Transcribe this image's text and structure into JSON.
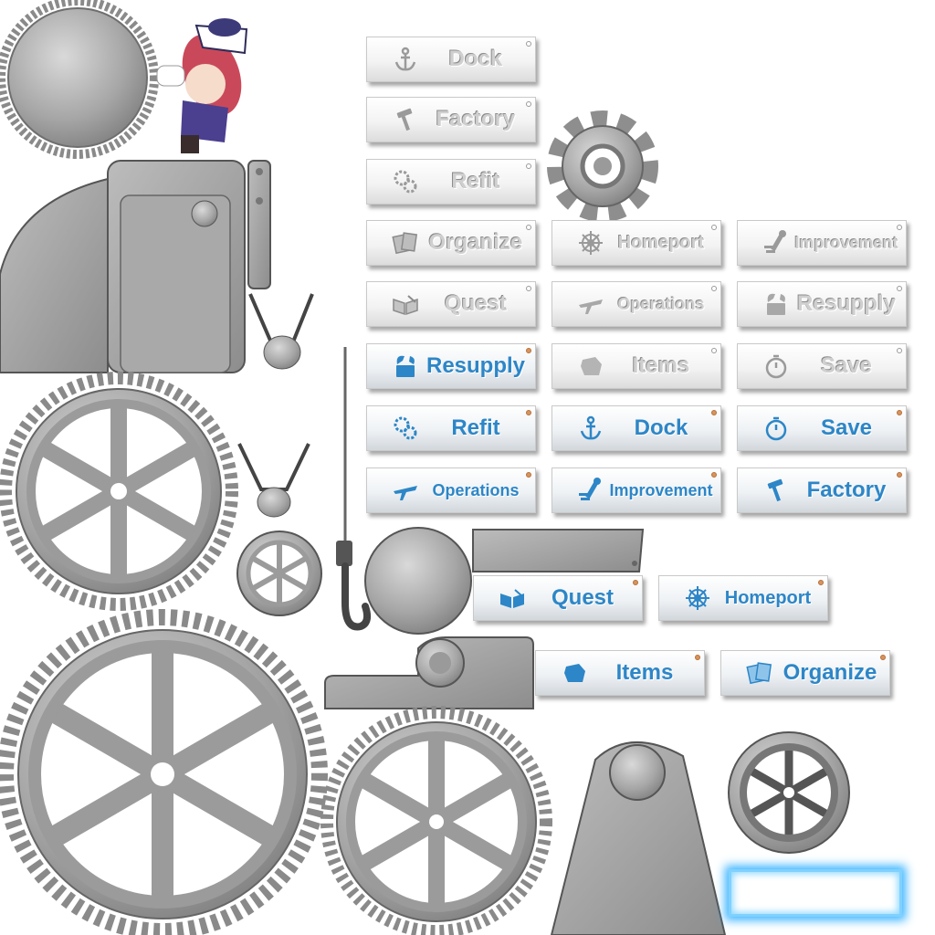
{
  "buttons": {
    "dock_idle": "Dock",
    "factory_idle": "Factory",
    "refit_idle": "Refit",
    "organize_idle": "Organize",
    "homeport_idle": "Homeport",
    "improvement_idle": "Improvement",
    "quest_idle": "Quest",
    "operations_idle": "Operations",
    "resupply_idle": "Resupply",
    "resupply_active": "Resupply",
    "items_idle": "Items",
    "save_idle": "Save",
    "refit_active": "Refit",
    "dock_active": "Dock",
    "save_active": "Save",
    "operations_active": "Operations",
    "improvement_active": "Improvement",
    "factory_active": "Factory",
    "quest_active": "Quest",
    "homeport_active": "Homeport",
    "items_active": "Items",
    "organize_active": "Organize"
  },
  "icons": {
    "dock": "anchor-icon",
    "factory": "hammer-icon",
    "refit": "gears-icon",
    "organize": "cards-icon",
    "homeport": "ship-wheel-icon",
    "improvement": "wrench-icon",
    "quest": "open-book-icon",
    "operations": "plane-icon",
    "resupply": "supply-box-icon",
    "items": "bag-icon",
    "save": "stopwatch-icon"
  },
  "colors": {
    "active_text": "#2d86c7",
    "idle_text": "#cfcfcf",
    "metal": "#a4a4a4",
    "glow": "#3ab4ff"
  }
}
